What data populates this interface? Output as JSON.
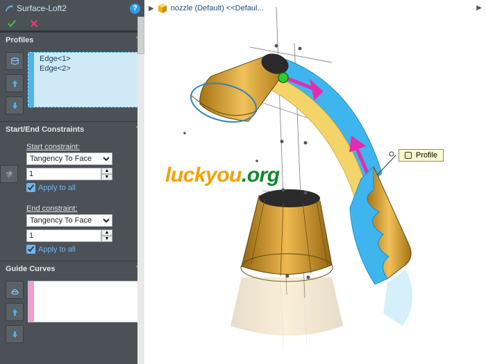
{
  "header": {
    "feature_name": "Surface-Loft2",
    "help_symbol": "?"
  },
  "accept": {
    "ok": "✓",
    "cancel": "✕"
  },
  "profiles": {
    "title": "Profiles",
    "items": [
      "Edge<1>",
      "Edge<2>"
    ]
  },
  "constraints": {
    "title": "Start/End Constraints",
    "start_label": "Start constraint:",
    "end_label": "End constraint:",
    "start_value": "Tangency To Face",
    "end_value": "Tangency To Face",
    "start_mag": "1",
    "end_mag": "1",
    "apply_label": "Apply to all"
  },
  "guide": {
    "title": "Guide Curves"
  },
  "viewport": {
    "breadcrumb_part": "nozzle (Default) <<Defaul...",
    "callout": "Profile",
    "watermark_a": "luckyou",
    "watermark_b": ".org"
  }
}
